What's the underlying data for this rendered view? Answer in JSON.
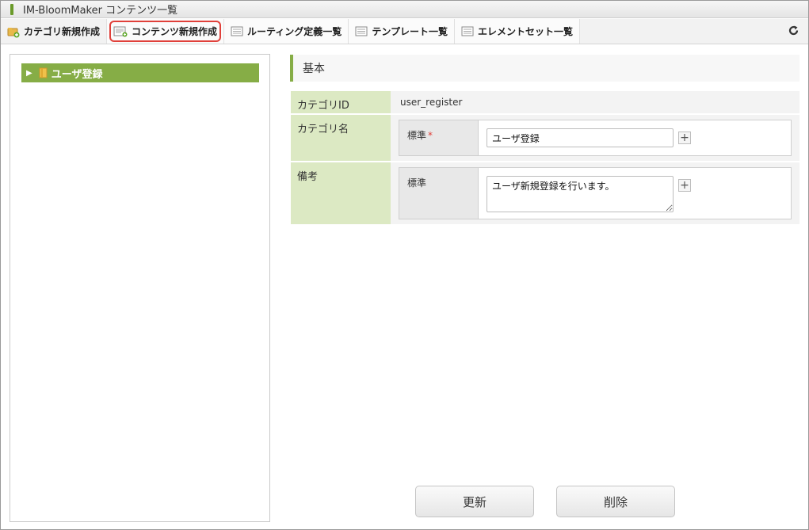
{
  "window": {
    "title": "IM-BloomMaker コンテンツ一覧"
  },
  "toolbar": {
    "items": [
      {
        "label": "カテゴリ新規作成",
        "icon": "folder-add-icon"
      },
      {
        "label": "コンテンツ新規作成",
        "icon": "page-add-icon",
        "highlighted": true
      },
      {
        "label": "ルーティング定義一覧",
        "icon": "list-icon"
      },
      {
        "label": "テンプレート一覧",
        "icon": "list-icon"
      },
      {
        "label": "エレメントセット一覧",
        "icon": "list-icon"
      }
    ],
    "refresh_icon": "refresh-icon"
  },
  "tree": {
    "nodes": [
      {
        "label": "ユーザ登録",
        "icon": "folder-icon",
        "selected": true
      }
    ]
  },
  "form": {
    "section_title": "基本",
    "category_id": {
      "label": "カテゴリID",
      "value": "user_register"
    },
    "category_name": {
      "label": "カテゴリ名",
      "sub_label": "標準",
      "required_mark": "*",
      "value": "ユーザ登録"
    },
    "remarks": {
      "label": "備考",
      "sub_label": "標準",
      "value": "ユーザ新規登録を行います。"
    }
  },
  "buttons": {
    "update": "更新",
    "delete": "削除"
  },
  "colors": {
    "accent_green": "#86ad46",
    "label_bg": "#dce9c3",
    "highlight_red": "#e0403a"
  }
}
